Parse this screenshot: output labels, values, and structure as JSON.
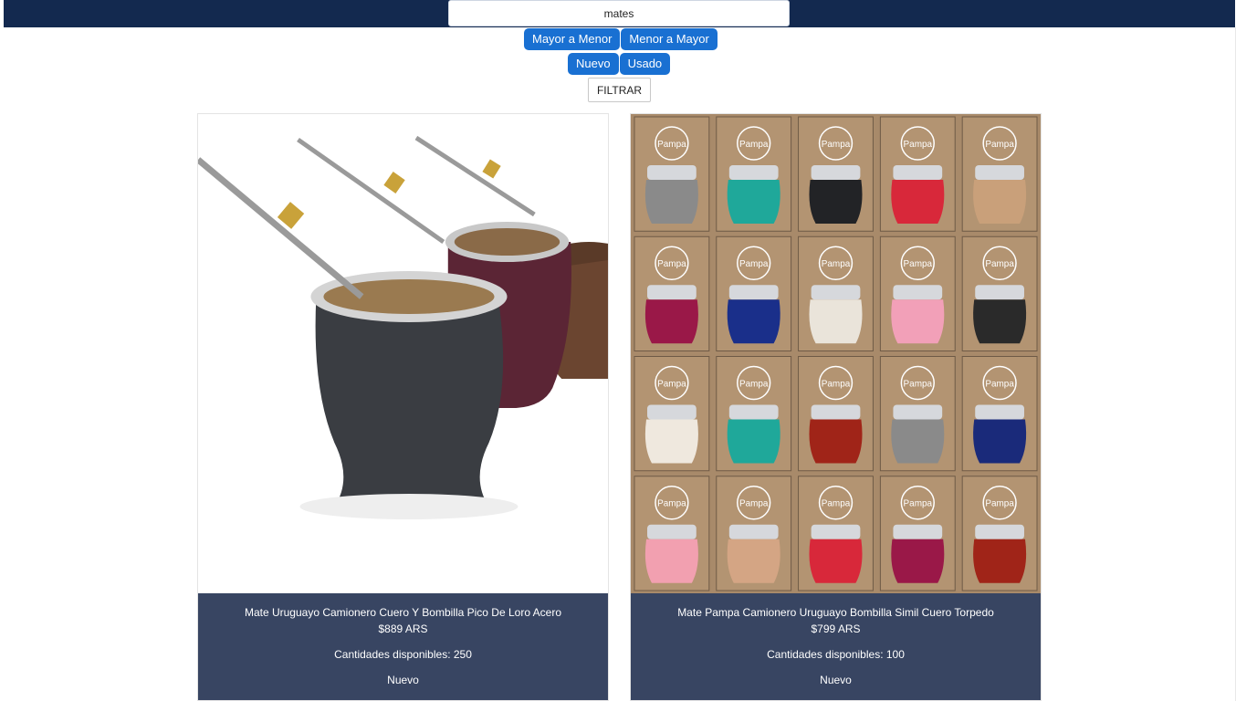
{
  "search": {
    "value": "mates"
  },
  "sort_buttons": [
    {
      "label": "Mayor a Menor"
    },
    {
      "label": "Menor a Mayor"
    }
  ],
  "condition_buttons": [
    {
      "label": "Nuevo"
    },
    {
      "label": "Usado"
    }
  ],
  "filter_button": {
    "label": "FILTRAR"
  },
  "products": [
    {
      "title": "Mate Uruguayo Camionero Cuero Y Bombilla Pico De Loro Acero",
      "price": "$889 ARS",
      "quantity": "Cantidades disponibles: 250",
      "condition": "Nuevo",
      "image_icon": "leather-mate-cups-photo"
    },
    {
      "title": "Mate Pampa Camionero Uruguayo Bombilla Simil Cuero Torpedo",
      "price": "$799 ARS",
      "quantity": "Cantidades disponibles: 100",
      "condition": "Nuevo",
      "image_icon": "mate-pampa-boxes-photo",
      "brand_print": "mate Pampa"
    }
  ],
  "colors": {
    "topbar": "#13294f",
    "pill": "#1970d2",
    "card_info": "#384562"
  }
}
